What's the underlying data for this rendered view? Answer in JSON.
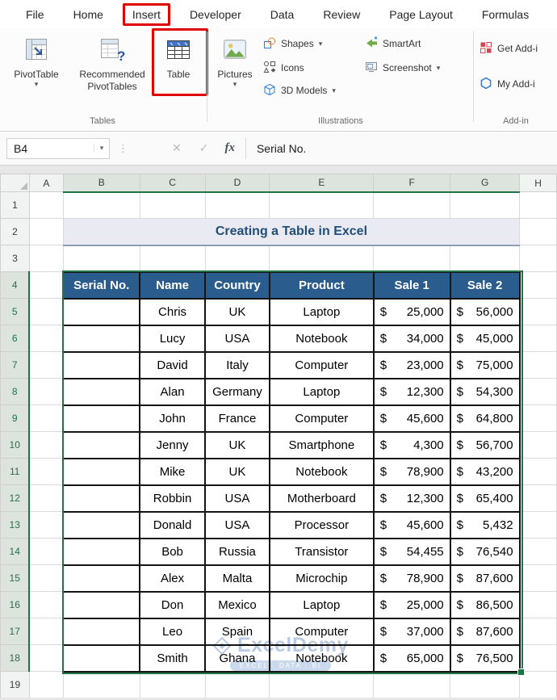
{
  "colors": {
    "accent_red": "#e00000",
    "excel_green": "#217346",
    "table_header_bg": "#2a5c8e",
    "title_text": "#1f4e79",
    "watermark_blue": "#b3c4e0"
  },
  "tab_bar": {
    "tabs": [
      {
        "label": "File"
      },
      {
        "label": "Home"
      },
      {
        "label": "Insert",
        "highlight": true
      },
      {
        "label": "Developer"
      },
      {
        "label": "Data"
      },
      {
        "label": "Review"
      },
      {
        "label": "Page Layout"
      },
      {
        "label": "Formulas"
      }
    ]
  },
  "ribbon": {
    "groups": [
      {
        "name": "Tables"
      },
      {
        "name": "Illustrations"
      },
      {
        "name": "Add-in"
      }
    ],
    "buttons": {
      "pivotTable": {
        "label": "PivotTable",
        "dropdown": true
      },
      "recommendedPivotTables": {
        "label1": "Recommended",
        "label2": "PivotTables"
      },
      "table": {
        "label": "Table",
        "highlight": true
      },
      "pictures": {
        "label": "Pictures",
        "dropdown": true
      },
      "shapes": {
        "label": "Shapes",
        "dropdown": true
      },
      "icons": {
        "label": "Icons"
      },
      "models3d": {
        "label": "3D Models",
        "dropdown": true
      },
      "smartart": {
        "label": "SmartArt"
      },
      "screenshot": {
        "label": "Screenshot",
        "dropdown": true
      },
      "getAddins": {
        "label": "Get Add-i"
      },
      "myAddins": {
        "label": "My Add-i"
      }
    }
  },
  "formula_bar": {
    "name_box": "B4",
    "fx": "fx",
    "value": "Serial No."
  },
  "sheet": {
    "col_labels": [
      "A",
      "B",
      "C",
      "D",
      "E",
      "F",
      "G",
      "H"
    ],
    "row_labels": [
      "1",
      "2",
      "3",
      "4",
      "5",
      "6",
      "7",
      "8",
      "9",
      "10",
      "11",
      "12",
      "13",
      "14",
      "15",
      "16",
      "17",
      "18",
      "19"
    ],
    "selected_cols": [
      "B",
      "C",
      "D",
      "E",
      "F",
      "G"
    ],
    "selected_rows_start": 4,
    "selected_rows_end": 18,
    "title": "Creating a Table in Excel",
    "table": {
      "headers": [
        "Serial No.",
        "Name",
        "Country",
        "Product",
        "Sale 1",
        "Sale 2"
      ],
      "rows": [
        [
          "",
          "Chris",
          "UK",
          "Laptop",
          "$ 25,000",
          "$ 56,000"
        ],
        [
          "",
          "Lucy",
          "USA",
          "Notebook",
          "$ 34,000",
          "$ 45,000"
        ],
        [
          "",
          "David",
          "Italy",
          "Computer",
          "$ 23,000",
          "$ 75,000"
        ],
        [
          "",
          "Alan",
          "Germany",
          "Laptop",
          "$ 12,300",
          "$ 54,300"
        ],
        [
          "",
          "John",
          "France",
          "Computer",
          "$ 45,600",
          "$ 64,800"
        ],
        [
          "",
          "Jenny",
          "UK",
          "Smartphone",
          "$ 4,300",
          "$ 56,700"
        ],
        [
          "",
          "Mike",
          "UK",
          "Notebook",
          "$ 78,900",
          "$ 43,200"
        ],
        [
          "",
          "Robbin",
          "USA",
          "Motherboard",
          "$ 12,300",
          "$ 65,400"
        ],
        [
          "",
          "Donald",
          "USA",
          "Processor",
          "$ 45,600",
          "$ 5,432"
        ],
        [
          "",
          "Bob",
          "Russia",
          "Transistor",
          "$ 54,455",
          "$ 76,540"
        ],
        [
          "",
          "Alex",
          "Malta",
          "Microchip",
          "$ 78,900",
          "$ 87,600"
        ],
        [
          "",
          "Don",
          "Mexico",
          "Laptop",
          "$ 25,000",
          "$ 86,500"
        ],
        [
          "",
          "Leo",
          "Spain",
          "Computer",
          "$ 37,000",
          "$ 87,600"
        ],
        [
          "",
          "Smith",
          "Ghana",
          "Notebook",
          "$ 65,000",
          "$ 76,500"
        ]
      ]
    }
  },
  "watermark": {
    "brand": "ExcelDemy",
    "tagline": "EXCEL · DATA · BI"
  }
}
